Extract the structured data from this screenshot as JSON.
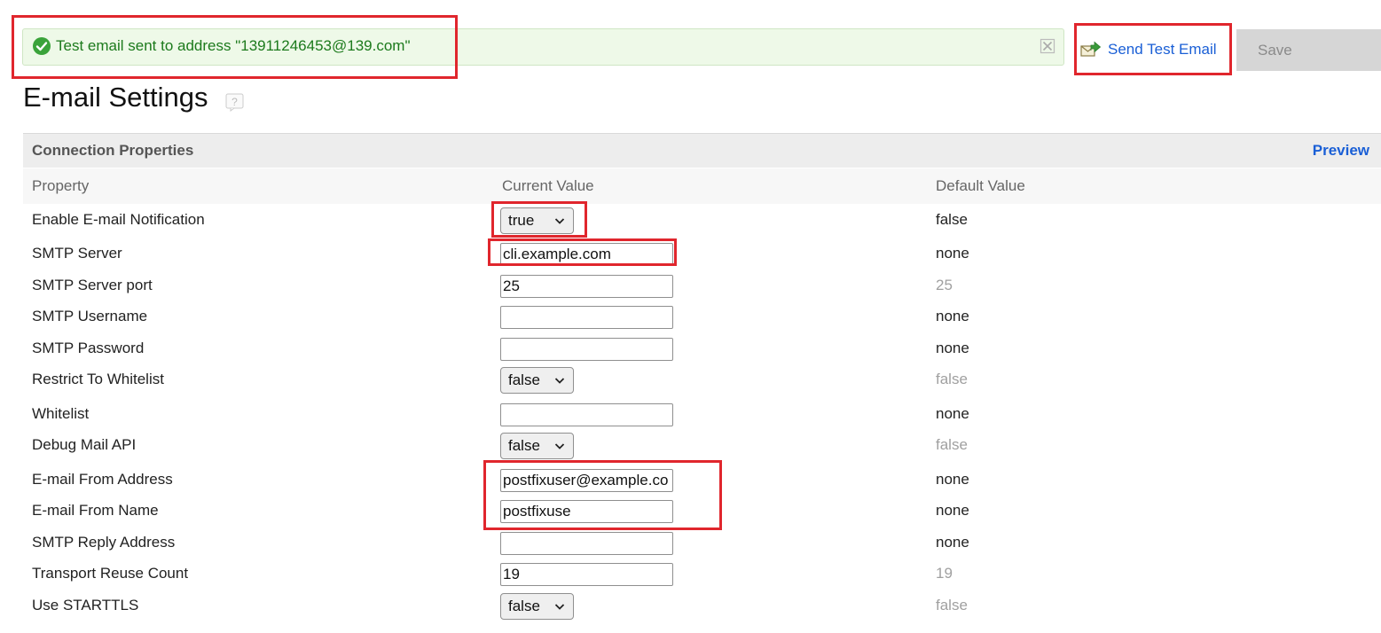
{
  "notice": {
    "message": "Test email sent to address \"13911246453@139.com\""
  },
  "toolbar": {
    "send_test_label": "Send Test Email",
    "save_label": "Save"
  },
  "page": {
    "title": "E-mail Settings"
  },
  "section": {
    "title": "Connection Properties",
    "preview_label": "Preview"
  },
  "columns": {
    "property": "Property",
    "current": "Current Value",
    "default": "Default Value"
  },
  "rows": [
    {
      "property": "Enable E-mail Notification",
      "control": "select",
      "value": "true",
      "default": "false",
      "default_muted": false
    },
    {
      "property": "SMTP Server",
      "control": "text",
      "value": "cli.example.com",
      "default": "none",
      "default_muted": false
    },
    {
      "property": "SMTP Server port",
      "control": "text",
      "value": "25",
      "default": "25",
      "default_muted": true
    },
    {
      "property": "SMTP Username",
      "control": "text",
      "value": "",
      "default": "none",
      "default_muted": false
    },
    {
      "property": "SMTP Password",
      "control": "text",
      "value": "",
      "default": "none",
      "default_muted": false
    },
    {
      "property": "Restrict To Whitelist",
      "control": "select",
      "value": "false",
      "default": "false",
      "default_muted": true
    },
    {
      "property": "Whitelist",
      "control": "text",
      "value": "",
      "default": "none",
      "default_muted": false
    },
    {
      "property": "Debug Mail API",
      "control": "select",
      "value": "false",
      "default": "false",
      "default_muted": true
    },
    {
      "property": "E-mail From Address",
      "control": "text",
      "value": "postfixuser@example.co",
      "default": "none",
      "default_muted": false
    },
    {
      "property": "E-mail From Name",
      "control": "text",
      "value": "postfixuse",
      "default": "none",
      "default_muted": false
    },
    {
      "property": "SMTP Reply Address",
      "control": "text",
      "value": "",
      "default": "none",
      "default_muted": false
    },
    {
      "property": "Transport Reuse Count",
      "control": "text",
      "value": "19",
      "default": "19",
      "default_muted": true
    },
    {
      "property": "Use STARTTLS",
      "control": "select",
      "value": "false",
      "default": "false",
      "default_muted": true
    }
  ],
  "colors": {
    "notice_bg": "#eef9e8",
    "notice_text": "#1c7a1c",
    "link": "#1a5fd6",
    "annotation_red": "#e0262d"
  },
  "icons": {
    "notice": "check-circle-icon",
    "close": "close-icon",
    "send": "send-mail-icon",
    "help": "help-icon",
    "select": "chevron-down-icon"
  }
}
